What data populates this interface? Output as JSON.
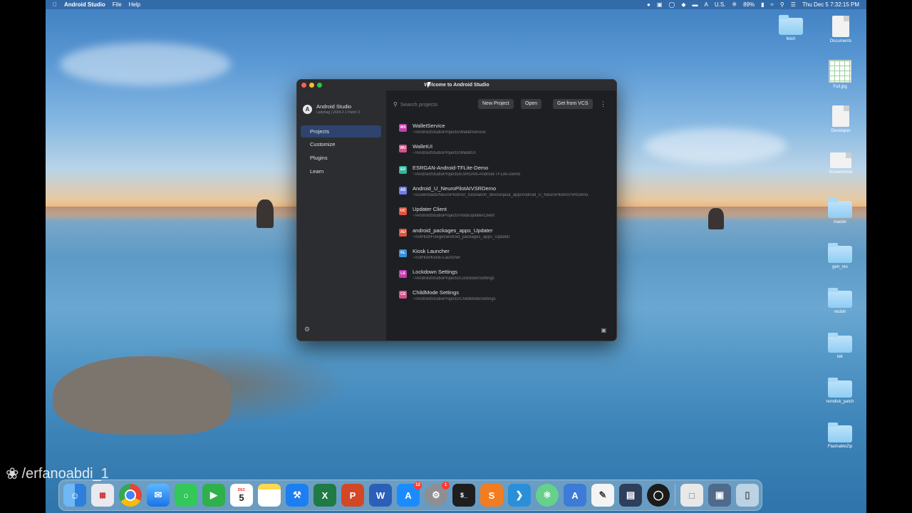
{
  "menubar": {
    "app": "Android Studio",
    "items": [
      "File",
      "Help"
    ],
    "tray": [
      "U.S.",
      "89%"
    ],
    "clock": "Thu Dec 5  7:32:15 PM"
  },
  "desktop": {
    "icons": [
      {
        "label": "fetch",
        "kind": "folder"
      },
      {
        "label": "Documents",
        "kind": "doc"
      },
      {
        "label": "Full.jpg",
        "kind": "sheet"
      },
      {
        "label": "Developer",
        "kind": "doc"
      },
      {
        "label": "Screenshots",
        "kind": "doc"
      },
      {
        "label": "master",
        "kind": "folder"
      },
      {
        "label": "gen_res",
        "kind": "folder"
      },
      {
        "label": "recbin",
        "kind": "folder"
      },
      {
        "label": "tek",
        "kind": "folder"
      },
      {
        "label": "remdisk_patch",
        "kind": "folder"
      },
      {
        "label": "FlashableZip",
        "kind": "folder"
      }
    ]
  },
  "window": {
    "title": "Welcome to Android Studio",
    "brand": {
      "name": "Android Studio",
      "version": "Ladybug | 2024.2.1 Patch 3"
    },
    "nav": [
      "Projects",
      "Customize",
      "Plugins",
      "Learn"
    ],
    "search_placeholder": "Search projects",
    "buttons": {
      "new_project": "New Project",
      "open": "Open",
      "vcs": "Get from VCS"
    },
    "projects": [
      {
        "abbr": "WS",
        "color": "#c23fb0",
        "name": "WalletService",
        "path": "~/AndroidStudioProjects/WalletService"
      },
      {
        "abbr": "WU",
        "color": "#d94f8a",
        "name": "WalletUI",
        "path": "~/AndroidStudioProjects/WalletUI"
      },
      {
        "abbr": "ED",
        "color": "#2fb59a",
        "name": "ESRGAN-Android-TFLite-Demo",
        "path": "~/AndroidStudioProjects/ESRGAN-Android-TFLite-Demo"
      },
      {
        "abbr": "AD",
        "color": "#6c7de8",
        "name": "Android_U_NeuroPilotAIVSRDemo",
        "path": "~/Downloads/NeuroPilot/nsr_tutorial/on_device/java_app/Android_U_NeuroPilotAIVSRDemo"
      },
      {
        "abbr": "UC",
        "color": "#e0533f",
        "name": "Updater Client",
        "path": "~/AndroidStudioProjects/VotaUpdaterClient"
      },
      {
        "abbr": "AU",
        "color": "#e0533f",
        "name": "android_packages_apps_Updater",
        "path": "~/GitHub/Fixegel/android_packages_apps_Updater"
      },
      {
        "abbr": "KL",
        "color": "#3d8fd9",
        "name": "Kiosk Launcher",
        "path": "~/GitHub/Kiosk-Launcher"
      },
      {
        "abbr": "LS",
        "color": "#c23fb0",
        "name": "Lockdown Settings",
        "path": "~/AndroidStudioProjects/LockdownSettings"
      },
      {
        "abbr": "CS",
        "color": "#d94f8a",
        "name": "ChildMode Settings",
        "path": "~/AndroidStudioProjects/ChildModeSettings"
      }
    ]
  },
  "dock": {
    "calendar": {
      "month": "DEC",
      "day": "5"
    },
    "badges": {
      "appstore": "12",
      "settings": "1"
    },
    "apps": [
      "finder",
      "launchpad",
      "chrome",
      "mail",
      "messages",
      "facetime",
      "calendar",
      "notes",
      "xcode",
      "excel",
      "powerpoint",
      "word",
      "appstore",
      "settings",
      "terminal",
      "sublime",
      "vscode",
      "atom",
      "android-studio",
      "textedit",
      "archive",
      "obs",
      "file",
      "preview",
      "trash"
    ]
  },
  "watermark": "/erfanoabdi_1"
}
